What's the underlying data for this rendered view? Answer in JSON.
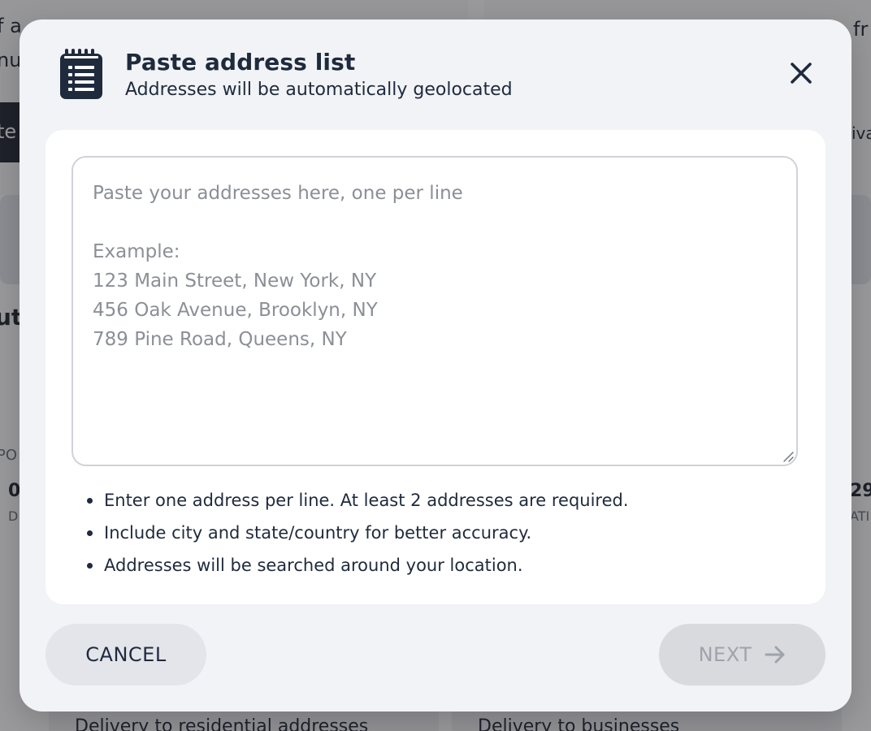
{
  "background": {
    "fragments": [
      "f a",
      "nu",
      "te",
      "fr",
      "iva",
      "ut",
      "PO",
      "0",
      "D",
      "29",
      "ATI",
      "Delivery to residential addresses",
      "Delivery to businesses"
    ]
  },
  "modal": {
    "title": "Paste address list",
    "subtitle": "Addresses will be automatically geolocated",
    "icon": "notepad-icon",
    "close_icon": "close-icon",
    "textarea": {
      "value": "",
      "placeholder_lines": [
        "Paste your addresses here, one per line",
        "",
        "Example:",
        "123 Main Street, New York, NY",
        "456 Oak Avenue, Brooklyn, NY",
        "789 Pine Road, Queens, NY"
      ]
    },
    "hints": [
      "Enter one address per line. At least 2 addresses are required.",
      "Include city and state/country for better accuracy.",
      "Addresses will be searched around your location."
    ],
    "cancel_label": "CANCEL",
    "next_label": "NEXT",
    "next_icon": "arrow-right-icon",
    "next_disabled": true
  },
  "colors": {
    "modal_bg": "#f1f3f6",
    "text": "#1f2a3d",
    "placeholder": "#8b8f96",
    "cancel_bg": "#e3e5ea",
    "next_disabled_bg": "#d8dade",
    "next_disabled_text": "#9fa3aa"
  }
}
